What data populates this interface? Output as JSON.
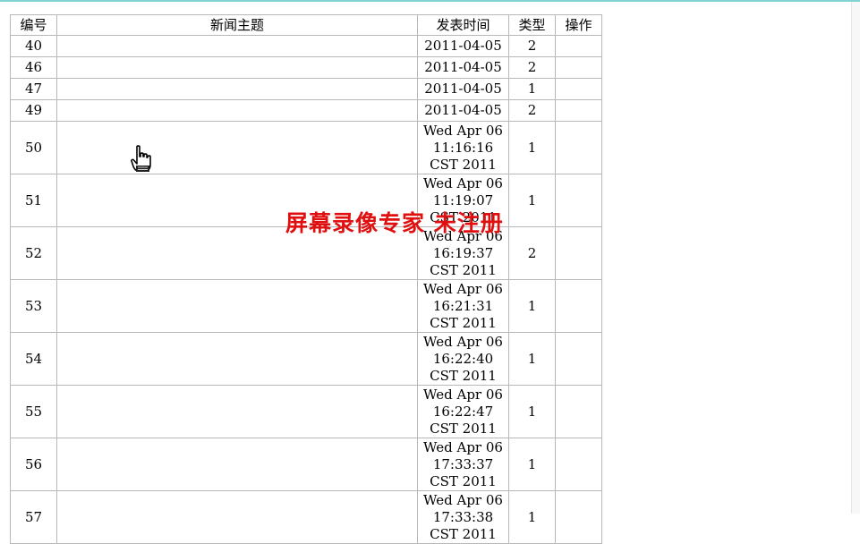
{
  "table": {
    "headers": {
      "id": "编号",
      "subject": "新闻主题",
      "time": "发表时间",
      "type": "类型",
      "op": "操作"
    },
    "rows": [
      {
        "id": "40",
        "subject": "",
        "time": "2011-04-05",
        "type": "2",
        "op": ""
      },
      {
        "id": "46",
        "subject": "",
        "time": "2011-04-05",
        "type": "2",
        "op": ""
      },
      {
        "id": "47",
        "subject": "",
        "time": "2011-04-05",
        "type": "1",
        "op": ""
      },
      {
        "id": "49",
        "subject": "",
        "time": "2011-04-05",
        "type": "2",
        "op": ""
      },
      {
        "id": "50",
        "subject": "",
        "time": "Wed Apr 06 11:16:16 CST 2011",
        "type": "1",
        "op": ""
      },
      {
        "id": "51",
        "subject": "",
        "time": "Wed Apr 06 11:19:07 CST 2011",
        "type": "1",
        "op": ""
      },
      {
        "id": "52",
        "subject": "",
        "time": "Wed Apr 06 16:19:37 CST 2011",
        "type": "2",
        "op": ""
      },
      {
        "id": "53",
        "subject": "",
        "time": "Wed Apr 06 16:21:31 CST 2011",
        "type": "1",
        "op": ""
      },
      {
        "id": "54",
        "subject": "",
        "time": "Wed Apr 06 16:22:40 CST 2011",
        "type": "1",
        "op": ""
      },
      {
        "id": "55",
        "subject": "",
        "time": "Wed Apr 06 16:22:47 CST 2011",
        "type": "1",
        "op": ""
      },
      {
        "id": "56",
        "subject": "",
        "time": "Wed Apr 06 17:33:37 CST 2011",
        "type": "1",
        "op": ""
      },
      {
        "id": "57",
        "subject": "",
        "time": "Wed Apr 06 17:33:38 CST 2011",
        "type": "1",
        "op": ""
      }
    ]
  },
  "watermark": "屏幕录像专家 未注册",
  "cursor_icon": "hand-pointer-icon",
  "colors": {
    "border": "#b8b8b8",
    "watermark": "#e01010",
    "top_line": "#7fd3d3"
  }
}
